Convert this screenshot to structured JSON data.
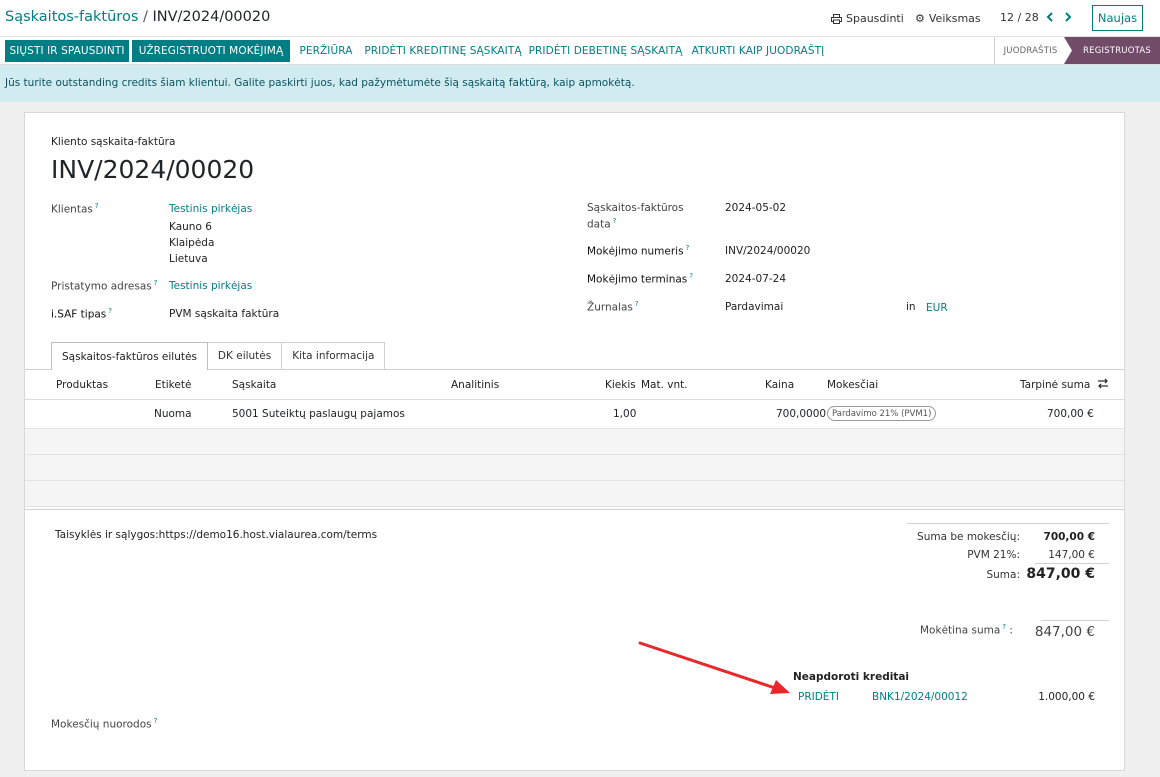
{
  "breadcrumb": {
    "parent": "Sąskaitos-faktūros",
    "separator": "/",
    "current": "INV/2024/00020"
  },
  "top": {
    "print_label": "Spausdinti",
    "action_label": "Veiksmas",
    "pager": "12 / 28",
    "new_label": "Naujas"
  },
  "actions": {
    "send_print": "SIŲSTI IR SPAUSDINTI",
    "register_payment": "UŽREGISTRUOTI MOKĖJIMĄ",
    "preview": "PERŽIŪRA",
    "add_credit_note": "PRIDĖTI KREDITINĘ SĄSKAITĄ",
    "add_debit_note": "PRIDĖTI DEBETINĘ SĄSKAITĄ",
    "reset_draft": "ATKURTI KAIP JUODRAŠTĮ"
  },
  "statusbar": {
    "draft": "JUODRAŠTIS",
    "posted": "REGISTRUOTAS"
  },
  "alert": "Jūs turite outstanding credits šiam klientui. Galite paskirti juos, kad pažymėtumėte šią sąskaitą faktūrą, kaip apmokėtą.",
  "invoice": {
    "type_label": "Kliento sąskaita-faktūra",
    "number": "INV/2024/00020",
    "customer_label": "Klientas",
    "customer_name": "Testinis pirkėjas",
    "customer_addr1": "Kauno 6",
    "customer_addr2": "Klaipėda",
    "customer_addr3": "Lietuva",
    "delivery_label": "Pristatymo adresas",
    "delivery_value": "Testinis pirkėjas",
    "isaf_label": "i.SAF tipas",
    "isaf_value": "PVM sąskaita faktūra",
    "date_label_1": "Sąskaitos-faktūros",
    "date_label_2": "data",
    "date_value": "2024-05-02",
    "payment_ref_label": "Mokėjimo numeris",
    "payment_ref_value": "INV/2024/00020",
    "payment_terms_label": "Mokėjimo terminas",
    "payment_terms_value": "2024-07-24",
    "journal_label": "Žurnalas",
    "journal_value": "Pardavimai",
    "in_label": "in",
    "currency": "EUR"
  },
  "tabs": [
    "Sąskaitos-faktūros eilutės",
    "DK eilutės",
    "Kita informacija"
  ],
  "table": {
    "headers": {
      "product": "Produktas",
      "label": "Etiketė",
      "account": "Sąskaita",
      "analytic": "Analitinis",
      "qty": "Kiekis",
      "uom": "Mat. vnt.",
      "price": "Kaina",
      "taxes": "Mokesčiai",
      "subtotal": "Tarpinė suma"
    },
    "row": {
      "label": "Nuoma",
      "account": "5001 Suteiktų paslaugų pajamos",
      "qty": "1,00",
      "price": "700,0000",
      "tax": "Pardavimo 21% (PVM1)",
      "subtotal": "700,00 €"
    }
  },
  "terms": "Taisyklės ir sąlygos:https://demo16.host.vialaurea.com/terms",
  "totals": {
    "untaxed_label": "Suma be mokesčių:",
    "untaxed_value": "700,00 €",
    "vat_label": "PVM 21%:",
    "vat_value": "147,00 €",
    "total_label": "Suma:",
    "total_value": "847,00 €",
    "due_label": "Mokėtina suma",
    "due_value": "847,00 €"
  },
  "credits": {
    "title": "Neapdoroti kreditai",
    "add_label": "PRIDĖTI",
    "ref": "BNK1/2024/00012",
    "amount": "1.000,00 €"
  },
  "tax_refs_label": "Mokesčių nuorodos",
  "colors": {
    "primary": "#017e84",
    "posted": "#714b67",
    "alert_bg": "#d1ecf1",
    "arrow": "#e8282b"
  }
}
